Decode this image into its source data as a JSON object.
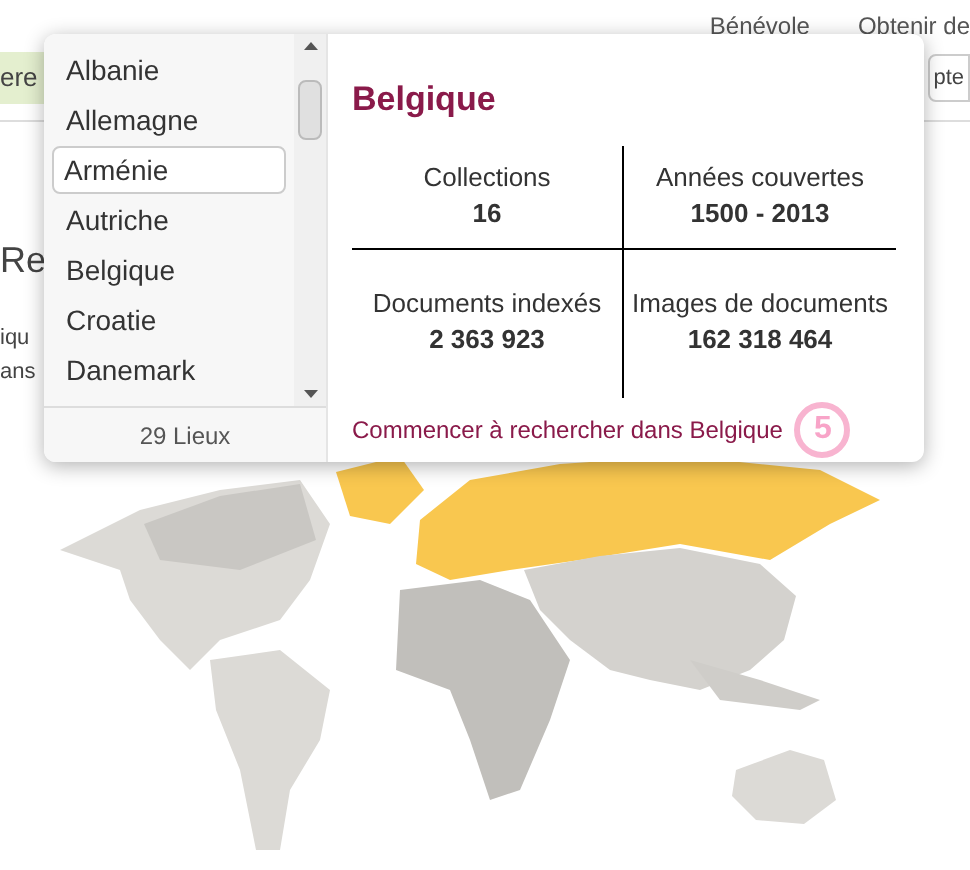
{
  "nav": [
    "Bénévole",
    "Obtenir de"
  ],
  "background": {
    "banner_text": "ere",
    "right_button": "pte",
    "heading": "Re",
    "text_lines": [
      "iqu",
      "ans"
    ]
  },
  "popup": {
    "places": [
      {
        "name": "Albanie",
        "selected": false
      },
      {
        "name": "Allemagne",
        "selected": false
      },
      {
        "name": "Arménie",
        "selected": true
      },
      {
        "name": "Autriche",
        "selected": false
      },
      {
        "name": "Belgique",
        "selected": false
      },
      {
        "name": "Croatie",
        "selected": false
      },
      {
        "name": "Danemark",
        "selected": false
      }
    ],
    "count": "29 Lieux",
    "title": "Belgique",
    "stats": [
      {
        "label": "Collections",
        "value": "16"
      },
      {
        "label": "Années couvertes",
        "value": "1500 - 2013"
      },
      {
        "label": "Documents indexés",
        "value": "2 363 923"
      },
      {
        "label": "Images de documents",
        "value": "162 318 464"
      }
    ],
    "link": "Commencer à rechercher dans Belgique"
  },
  "step_marker": "5"
}
